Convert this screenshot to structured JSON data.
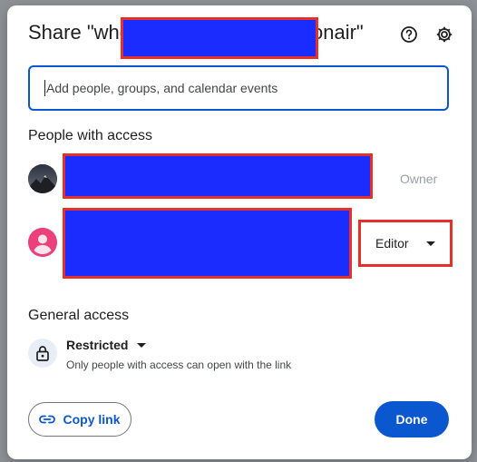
{
  "dialog": {
    "title_prefix": "Share \"whe",
    "title_suffix": "onair\"",
    "help_icon": "help-circle-icon",
    "settings_icon": "gear-icon"
  },
  "add_people": {
    "placeholder": "Add people, groups, and calendar events"
  },
  "people_with_access": {
    "heading": "People with access",
    "owner": {
      "role_label": "Owner",
      "avatar": "mountain-photo-avatar"
    },
    "editor": {
      "role_label": "Editor",
      "avatar": "default-person-avatar"
    }
  },
  "general_access": {
    "heading": "General access",
    "level": "Restricted",
    "description": "Only people with access can open with the link",
    "icon": "lock-icon"
  },
  "footer": {
    "copy_link": "Copy link",
    "copy_icon": "link-icon",
    "done": "Done"
  },
  "colors": {
    "accent": "#0b57d0",
    "redaction_fill": "#1a2cff",
    "redaction_border": "#e8302b"
  }
}
